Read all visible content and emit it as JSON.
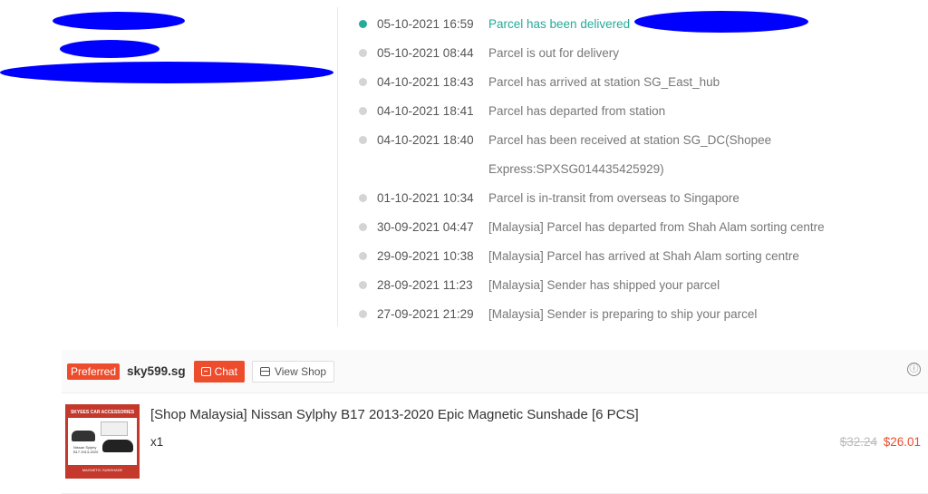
{
  "timeline": {
    "events": [
      {
        "time": "05-10-2021 16:59",
        "desc": "Parcel has been delivered"
      },
      {
        "time": "05-10-2021 08:44",
        "desc": "Parcel is out for delivery"
      },
      {
        "time": "04-10-2021 18:43",
        "desc": "Parcel has arrived at station SG_East_hub"
      },
      {
        "time": "04-10-2021 18:41",
        "desc": "Parcel has departed from station"
      },
      {
        "time": "04-10-2021 18:40",
        "desc": "Parcel has been received at station SG_DC(Shopee",
        "desc_cont": "Express:SPXSG014435425929)"
      },
      {
        "time": "01-10-2021 10:34",
        "desc": "Parcel is in-transit from overseas to Singapore"
      },
      {
        "time": "30-09-2021 04:47",
        "desc": "[Malaysia] Parcel has departed from Shah Alam sorting centre"
      },
      {
        "time": "29-09-2021 10:38",
        "desc": "[Malaysia] Parcel has arrived at Shah Alam sorting centre"
      },
      {
        "time": "28-09-2021 11:23",
        "desc": "[Malaysia] Sender has shipped your parcel"
      },
      {
        "time": "27-09-2021 21:29",
        "desc": "[Malaysia] Sender is preparing to ship your parcel"
      }
    ]
  },
  "shop": {
    "badge": "Preferred",
    "name": "sky599.sg",
    "chat_label": "Chat",
    "view_shop_label": "View Shop",
    "info_icon": "ⓘ"
  },
  "product": {
    "title": "[Shop Malaysia] Nissan Sylphy B17 2013-2020 Epic Magnetic Sunshade [6 PCS]",
    "qty": "x1",
    "price_original": "$32.24",
    "price_current": "$26.01",
    "thumb_top": "SKYEES CAR ACCESSORIES",
    "thumb_mid": "Nissan Sylphy B17 2013-2020",
    "thumb_bottom": "MAGNETIC SUNSHADE"
  },
  "colors": {
    "accent": "#ee4d2d",
    "delivered": "#26aa99",
    "redaction": "#0000ff"
  }
}
